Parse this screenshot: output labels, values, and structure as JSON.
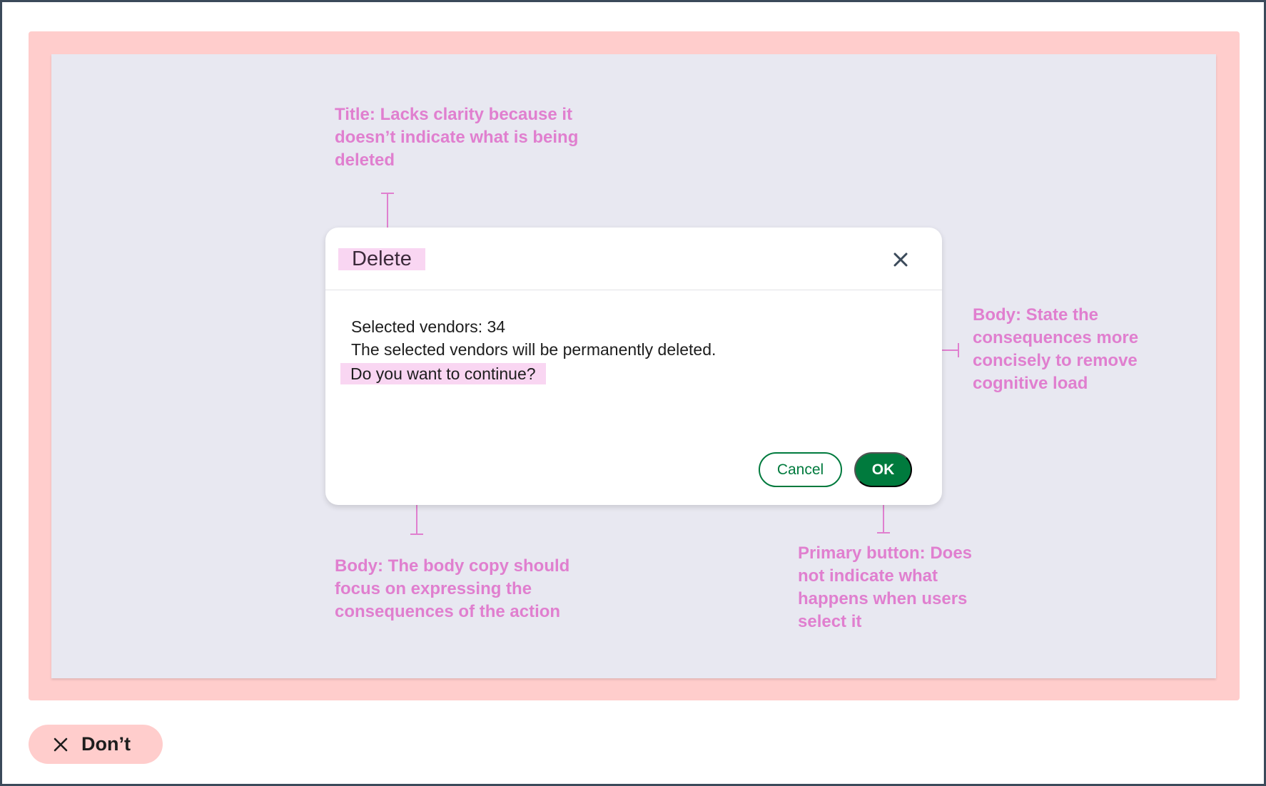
{
  "annotations": {
    "title_note": "Title: Lacks clarity because it\ndoesn’t indicate what is being\ndeleted",
    "body_consequences_note": "Body: State the\nconsequences more\nconcisely to remove\ncognitive load",
    "body_focus_note": "Body: The body copy should\nfocus on expressing the\nconsequences of the action",
    "primary_button_note": "Primary button: Does\nnot indicate what\nhappens when users\nselect it"
  },
  "dialog": {
    "title": "Delete",
    "close_icon": "close-icon",
    "body": {
      "line1": "Selected vendors: 34",
      "line2": "The selected vendors will be permanently deleted.",
      "line3": "Do you want to continue?"
    },
    "buttons": {
      "cancel": "Cancel",
      "ok": "OK"
    }
  },
  "badge": {
    "icon": "x-icon",
    "label": "Don’t"
  },
  "colors": {
    "annotation": "#e07fcf",
    "primary": "#007a3d",
    "panel": "#ffcdcc",
    "canvas": "#e8e8f1",
    "highlight": "#f9d6f2"
  }
}
